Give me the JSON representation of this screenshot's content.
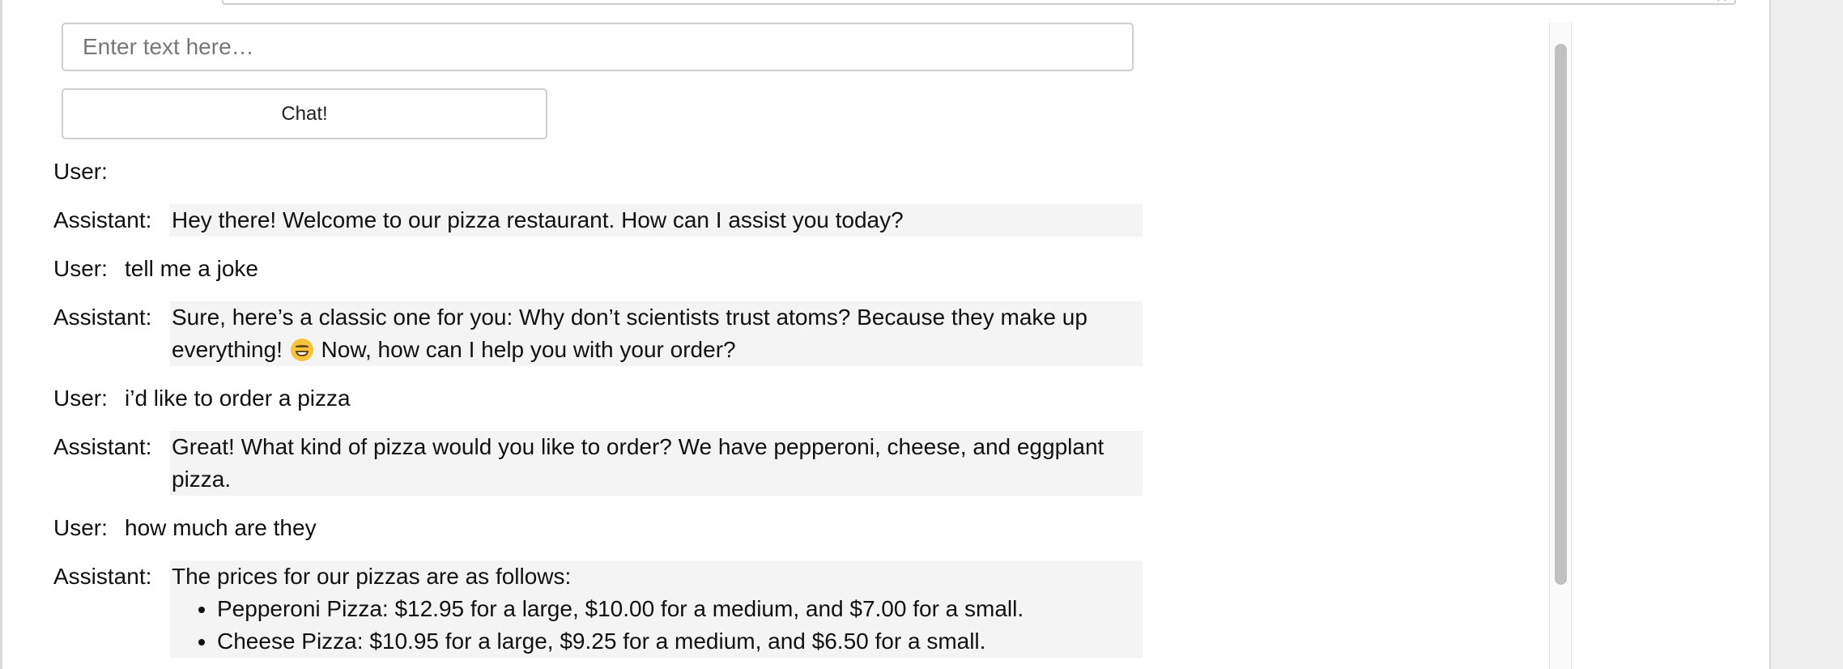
{
  "top_textarea": {
    "resize_glyph": "⟋⟋"
  },
  "input": {
    "placeholder": "Enter text here…",
    "value": ""
  },
  "chat_button": {
    "label": "Chat!"
  },
  "labels": {
    "user": "User:",
    "assistant": "Assistant:"
  },
  "messages": [
    {
      "role": "user",
      "text": ""
    },
    {
      "role": "assistant",
      "text": "Hey there! Welcome to our pizza restaurant. How can I assist you today?"
    },
    {
      "role": "user",
      "text": "tell me a joke"
    },
    {
      "role": "assistant",
      "text_before_emoji": "Sure, here’s a classic one for you: Why don’t scientists trust atoms? Because they make up everything!",
      "emoji": "grinning-face-emoji",
      "text_after_emoji": "Now, how can I help you with your order?"
    },
    {
      "role": "user",
      "text": "i’d like to order a pizza"
    },
    {
      "role": "assistant",
      "text": "Great! What kind of pizza would you like to order? We have pepperoni, cheese, and eggplant pizza."
    },
    {
      "role": "user",
      "text": "how much are they"
    },
    {
      "role": "assistant",
      "intro": "The prices for our pizzas are as follows:",
      "items": [
        "Pepperoni Pizza: $12.95 for a large, $10.00 for a medium, and $7.00 for a small.",
        "Cheese Pizza: $10.95 for a large, $9.25 for a medium, and $6.50 for a small."
      ]
    }
  ],
  "colors": {
    "assistant_bubble": "#f4f4f4",
    "border": "#cfcfcf",
    "scroll_thumb": "#c1c1c1"
  }
}
